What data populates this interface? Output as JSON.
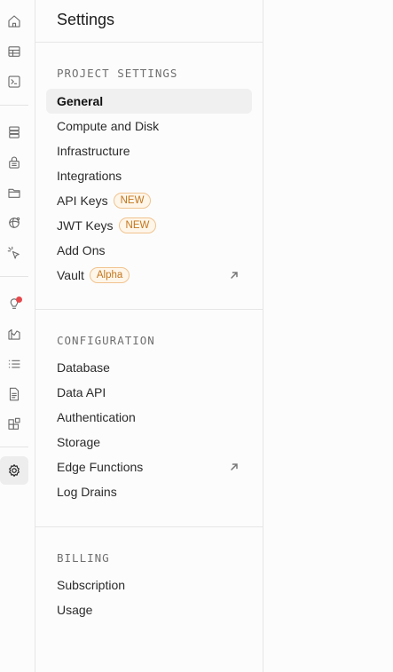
{
  "panel": {
    "title": "Settings"
  },
  "sections": {
    "project": {
      "label": "PROJECT SETTINGS",
      "items": {
        "general": "General",
        "compute": "Compute and Disk",
        "infrastructure": "Infrastructure",
        "integrations": "Integrations",
        "api_keys": "API Keys",
        "api_keys_badge": "NEW",
        "jwt_keys": "JWT Keys",
        "jwt_keys_badge": "NEW",
        "add_ons": "Add Ons",
        "vault": "Vault",
        "vault_badge": "Alpha"
      }
    },
    "configuration": {
      "label": "CONFIGURATION",
      "items": {
        "database": "Database",
        "data_api": "Data API",
        "authentication": "Authentication",
        "storage": "Storage",
        "edge_functions": "Edge Functions",
        "log_drains": "Log Drains"
      }
    },
    "billing": {
      "label": "BILLING",
      "items": {
        "subscription": "Subscription",
        "usage": "Usage"
      }
    }
  },
  "rail": {
    "icons": [
      "home-icon",
      "table-editor-icon",
      "sql-editor-icon",
      "database-icon",
      "auth-lock-icon",
      "storage-folder-icon",
      "realtime-icon",
      "edge-functions-cursor-icon",
      "advisors-lightbulb-icon",
      "reports-chart-icon",
      "logs-list-icon",
      "api-docs-icon",
      "integrations-blocks-icon",
      "settings-gear-icon"
    ],
    "active": "settings-gear-icon"
  },
  "colors": {
    "badge_text": "#c2761d",
    "badge_border": "#f0c38f",
    "notif_dot": "#e5484d"
  }
}
